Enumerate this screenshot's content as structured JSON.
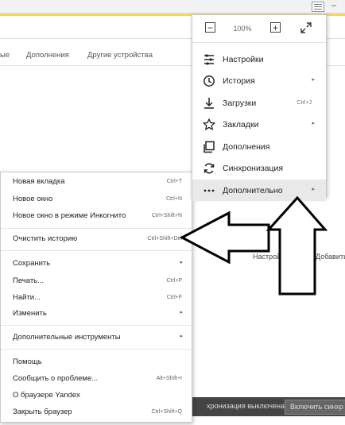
{
  "browser": {
    "nav_links": [
      "ые",
      "Дополнения",
      "Другие устройства"
    ],
    "settings_link": "Настройка",
    "add_link": "Добавить",
    "plus": "+",
    "sync_status": "хронизация выключена",
    "sync_button": "Включить синхр"
  },
  "main_menu": {
    "zoom": {
      "minus": "−",
      "value": "100%",
      "plus": "+"
    },
    "items": [
      {
        "label": "Настройки",
        "icon": "settings-sliders-icon"
      },
      {
        "label": "История",
        "icon": "clock-icon"
      },
      {
        "label": "Загрузки",
        "icon": "download-icon",
        "shortcut": "Ctrl+J"
      },
      {
        "label": "Закладки",
        "icon": "star-icon"
      },
      {
        "label": "Дополнения",
        "icon": "extensions-icon"
      },
      {
        "label": "Синхронизация",
        "icon": "sync-icon"
      },
      {
        "label": "Дополнительно",
        "icon": "more-dots-icon"
      }
    ]
  },
  "sub_menu": {
    "items": [
      {
        "label": "Новая вкладка",
        "shortcut": "Ctrl+T"
      },
      {
        "label": "Новое окно",
        "shortcut": "Ctrl+N"
      },
      {
        "label": "Новое окно в режиме Инкогнито",
        "shortcut": "Ctrl+Shift+N"
      },
      {
        "label": "Очистить историю",
        "shortcut": "Ctrl+Shift+Del"
      },
      {
        "label": "Сохранить"
      },
      {
        "label": "Печать...",
        "shortcut": "Ctrl+P"
      },
      {
        "label": "Найти...",
        "shortcut": "Ctrl+F"
      },
      {
        "label": "Изменить"
      },
      {
        "label": "Дополнительные инструменты"
      },
      {
        "label": "Помощь"
      },
      {
        "label": "Сообщить о проблеме...",
        "shortcut": "Alt+Shift+I"
      },
      {
        "label": "О браузере Yandex"
      },
      {
        "label": "Закрыть браузер",
        "shortcut": "Ctrl+Shift+Q"
      }
    ]
  }
}
